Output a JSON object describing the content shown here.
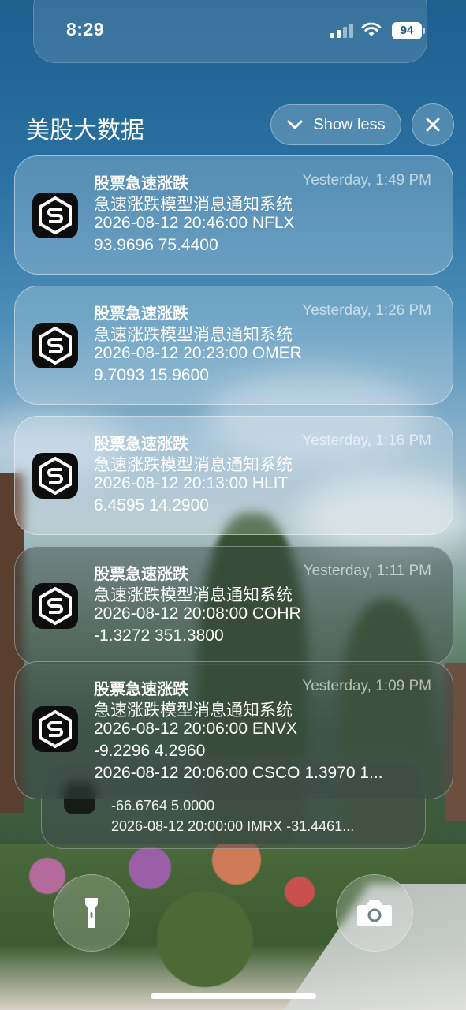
{
  "status_bar": {
    "time": "8:29",
    "battery": "94"
  },
  "group": {
    "title": "美股大数据",
    "show_less_label": "Show less"
  },
  "notifications": [
    {
      "app": "股票急速涨跌",
      "time": "Yesterday, 1:49 PM",
      "lines": [
        "急速涨跌模型消息通知系统",
        "2026-08-12 20:46:00 NFLX",
        "93.9696 75.4400"
      ]
    },
    {
      "app": "股票急速涨跌",
      "time": "Yesterday, 1:26 PM",
      "lines": [
        "急速涨跌模型消息通知系统",
        "2026-08-12 20:23:00 OMER",
        "9.7093 15.9600"
      ]
    },
    {
      "app": "股票急速涨跌",
      "time": "Yesterday, 1:16 PM",
      "lines": [
        "急速涨跌模型消息通知系统",
        "2026-08-12 20:13:00 HLIT",
        "6.4595 14.2900"
      ]
    },
    {
      "app": "股票急速涨跌",
      "time": "Yesterday, 1:11 PM",
      "lines": [
        "急速涨跌模型消息通知系统",
        "2026-08-12 20:08:00 COHR",
        "-1.3272 351.3800"
      ]
    },
    {
      "app": "股票急速涨跌",
      "time": "Yesterday, 1:09 PM",
      "lines": [
        "急速涨跌模型消息通知系统",
        "2026-08-12 20:06:00 ENVX",
        "-9.2296 4.2960",
        "2026-08-12 20:06:00 CSCO 1.3970 1..."
      ]
    }
  ],
  "stacked_notification": {
    "lines": [
      "-66.6764 5.0000",
      "2026-08-12 20:00:00 IMRX -31.4461..."
    ]
  },
  "icons": {
    "app": "s-hexagon-logo-icon",
    "flashlight": "flashlight-icon",
    "camera": "camera-icon",
    "chevron": "chevron-down-icon",
    "close": "close-icon"
  }
}
